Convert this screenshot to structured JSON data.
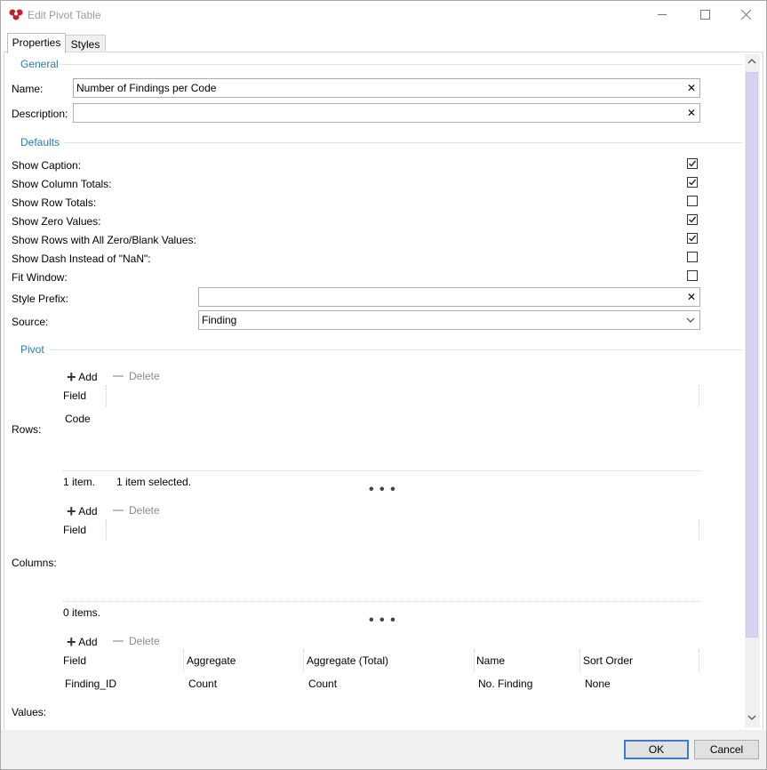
{
  "window": {
    "title": "Edit Pivot Table"
  },
  "tabs": [
    {
      "label": "Properties",
      "active": true
    },
    {
      "label": "Styles",
      "active": false
    }
  ],
  "general": {
    "section": "General",
    "name_label": "Name:",
    "name_value": "Number of Findings per Code",
    "description_label": "Description:",
    "description_value": ""
  },
  "defaults": {
    "section": "Defaults",
    "options": [
      {
        "label": "Show Caption:",
        "checked": true
      },
      {
        "label": "Show Column Totals:",
        "checked": true
      },
      {
        "label": "Show Row Totals:",
        "checked": false
      },
      {
        "label": "Show Zero Values:",
        "checked": true
      },
      {
        "label": "Show Rows with All Zero/Blank Values:",
        "checked": true
      },
      {
        "label": "Show Dash Instead of \"NaN\":",
        "checked": false
      },
      {
        "label": "Fit Window:",
        "checked": false
      }
    ],
    "style_prefix_label": "Style Prefix:",
    "style_prefix_value": "",
    "source_label": "Source:",
    "source_value": "Finding"
  },
  "pivot": {
    "section": "Pivot",
    "add_label": "Add",
    "delete_label": "Delete",
    "more_label": "• • •",
    "rows": {
      "label": "Rows:",
      "header": "Field",
      "items": [
        "Code"
      ],
      "status_count": "1 item.",
      "status_selected": "1 item selected."
    },
    "columns": {
      "label": "Columns:",
      "header": "Field",
      "status_count": "0 items."
    },
    "values": {
      "label": "Values:",
      "headers": [
        "Field",
        "Aggregate",
        "Aggregate (Total)",
        "Name",
        "Sort Order"
      ],
      "row": [
        "Finding_ID",
        "Count",
        "Count",
        "No. Finding",
        "None"
      ]
    }
  },
  "buttons": {
    "ok": "OK",
    "cancel": "Cancel"
  }
}
